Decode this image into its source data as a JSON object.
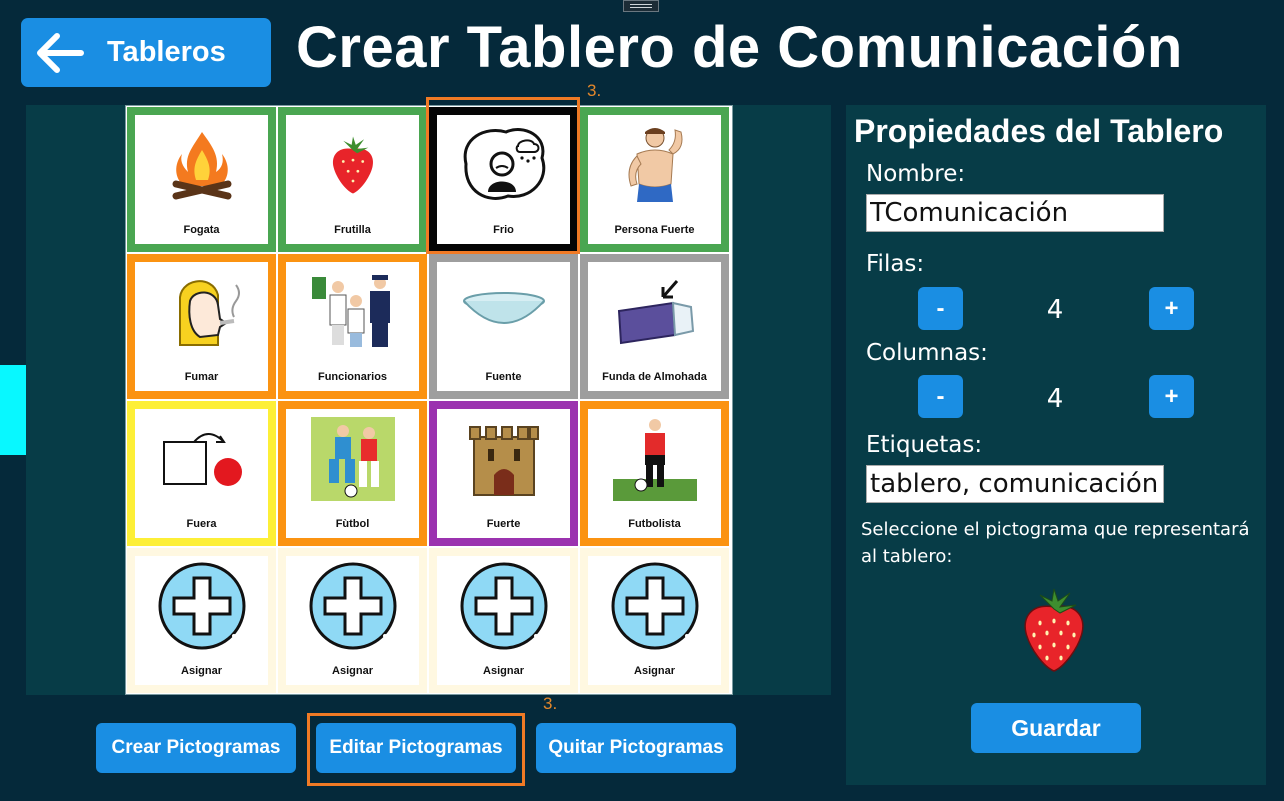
{
  "header": {
    "back_label": "Tableros",
    "title": "Crear Tablero de Comunicación"
  },
  "steps": {
    "cell_step": "3.",
    "button_step": "3."
  },
  "board": {
    "cells": [
      {
        "label": "Fogata",
        "border": "green",
        "icon": "campfire-icon"
      },
      {
        "label": "Frutilla",
        "border": "green",
        "icon": "strawberry-icon"
      },
      {
        "label": "Frio",
        "border": "black",
        "icon": "cold-person-icon"
      },
      {
        "label": "Persona Fuerte",
        "border": "green",
        "icon": "strong-person-icon"
      },
      {
        "label": "Fumar",
        "border": "orange",
        "icon": "smoking-icon"
      },
      {
        "label": "Funcionarios",
        "border": "orange",
        "icon": "officials-icon"
      },
      {
        "label": "Fuente",
        "border": "gray",
        "icon": "bowl-icon"
      },
      {
        "label": "Funda de Almohada",
        "border": "gray",
        "icon": "pillowcase-icon"
      },
      {
        "label": "Fuera",
        "border": "yellow",
        "icon": "outside-icon"
      },
      {
        "label": "Fùtbol",
        "border": "orange",
        "icon": "football-icon"
      },
      {
        "label": "Fuerte",
        "border": "purple",
        "icon": "fort-icon"
      },
      {
        "label": "Futbolista",
        "border": "orange",
        "icon": "footballer-icon"
      },
      {
        "label": "Asignar",
        "border": "cream",
        "icon": "add-icon"
      },
      {
        "label": "Asignar",
        "border": "cream",
        "icon": "add-icon"
      },
      {
        "label": "Asignar",
        "border": "cream",
        "icon": "add-icon"
      },
      {
        "label": "Asignar",
        "border": "cream",
        "icon": "add-icon"
      }
    ]
  },
  "actions": {
    "create": "Crear Pictogramas",
    "edit": "Editar Pictogramas",
    "remove": "Quitar Pictogramas"
  },
  "properties": {
    "title": "Propiedades del Tablero",
    "name_label": "Nombre:",
    "name_value": "TComunicación",
    "rows_label": "Filas:",
    "rows_value": "4",
    "cols_label": "Columnas:",
    "cols_value": "4",
    "minus": "-",
    "plus": "+",
    "tags_label": "Etiquetas:",
    "tags_value": "tablero, comunicación",
    "hint": "Seleccione el pictograma que representará al tablero:",
    "board_icon": "strawberry-icon",
    "save_label": "Guardar"
  },
  "colors": {
    "background": "#05293a",
    "panel": "#073c47",
    "accent": "#1a8ee3",
    "highlight": "#f07a25",
    "side_tab": "#08f8ff"
  }
}
